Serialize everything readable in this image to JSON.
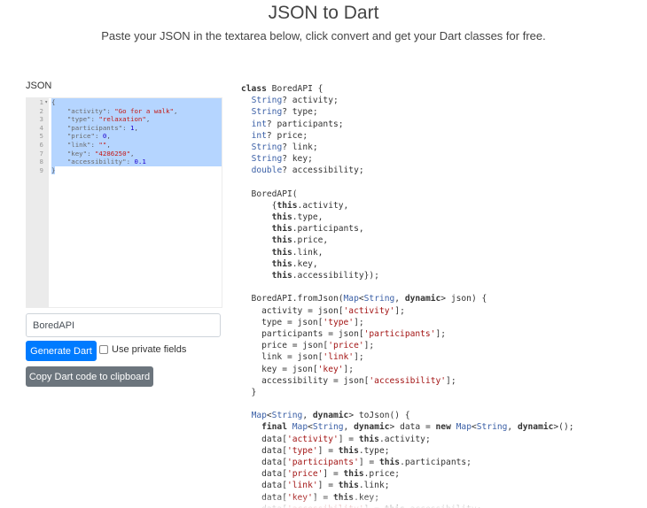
{
  "header": {
    "title": "JSON to Dart",
    "subtitle": "Paste your JSON in the textarea below, click convert and get your Dart classes for free."
  },
  "editor": {
    "label": "JSON",
    "line_numbers": [
      "1",
      "2",
      "3",
      "4",
      "5",
      "6",
      "7",
      "8",
      "9"
    ],
    "json": {
      "activity": "Go for a walk",
      "type": "relaxation",
      "participants": 1,
      "price": 0,
      "link": "",
      "key": "4286250",
      "accessibility": 0.1
    }
  },
  "form": {
    "class_name_value": "BoredAPI",
    "generate_button": "Generate Dart",
    "private_fields_label": "Use private fields",
    "private_fields_checked": false,
    "copy_button": "Copy Dart code to clipboard"
  },
  "output": {
    "lines": [
      "class BoredAPI {",
      "  String? activity;",
      "  String? type;",
      "  int? participants;",
      "  int? price;",
      "  String? link;",
      "  String? key;",
      "  double? accessibility;",
      "",
      "  BoredAPI(",
      "      {this.activity,",
      "      this.type,",
      "      this.participants,",
      "      this.price,",
      "      this.link,",
      "      this.key,",
      "      this.accessibility});",
      "",
      "  BoredAPI.fromJson(Map<String, dynamic> json) {",
      "    activity = json['activity'];",
      "    type = json['type'];",
      "    participants = json['participants'];",
      "    price = json['price'];",
      "    link = json['link'];",
      "    key = json['key'];",
      "    accessibility = json['accessibility'];",
      "  }",
      "",
      "  Map<String, dynamic> toJson() {",
      "    final Map<String, dynamic> data = new Map<String, dynamic>();",
      "    data['activity'] = this.activity;",
      "    data['type'] = this.type;",
      "    data['participants'] = this.participants;",
      "    data['price'] = this.price;",
      "    data['link'] = this.link;",
      "    data['key'] = this.key;",
      "    data['accessibility'] = this.accessibility;"
    ]
  },
  "colors": {
    "primary": "#007bff",
    "secondary": "#6c757d",
    "selection": "#b5d5ff"
  }
}
